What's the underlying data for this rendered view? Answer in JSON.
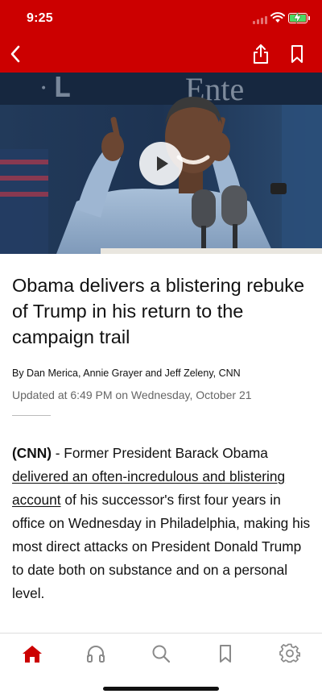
{
  "status": {
    "time": "9:25"
  },
  "toolbar": {
    "back": "back",
    "share": "share",
    "bookmark": "bookmark"
  },
  "article": {
    "headline": "Obama delivers a blistering rebuke of Trump in his return to the campaign trail",
    "byline": "By Dan Merica, Annie Grayer and Jeff Zeleny, CNN",
    "updated": "Updated at 6:49 PM on Wednesday, October 21",
    "source": "(CNN)",
    "dash": " - Former President Barack Obama ",
    "link_text": "delivered an often-incredulous and blistering account",
    "body_rest": " of his successor's first four years in office on Wednesday in Philadelphia, making his most direct attacks on President Donald Trump to date both on substance and on a personal level."
  },
  "tabs": [
    {
      "name": "home",
      "icon": "home-icon",
      "active": true
    },
    {
      "name": "listen",
      "icon": "headphones-icon",
      "active": false
    },
    {
      "name": "search",
      "icon": "search-icon",
      "active": false
    },
    {
      "name": "saved",
      "icon": "bookmark-icon",
      "active": false
    },
    {
      "name": "settings",
      "icon": "gear-icon",
      "active": false
    }
  ],
  "colors": {
    "brand": "#cc0000",
    "inactive_icon": "#8a8a8a"
  }
}
